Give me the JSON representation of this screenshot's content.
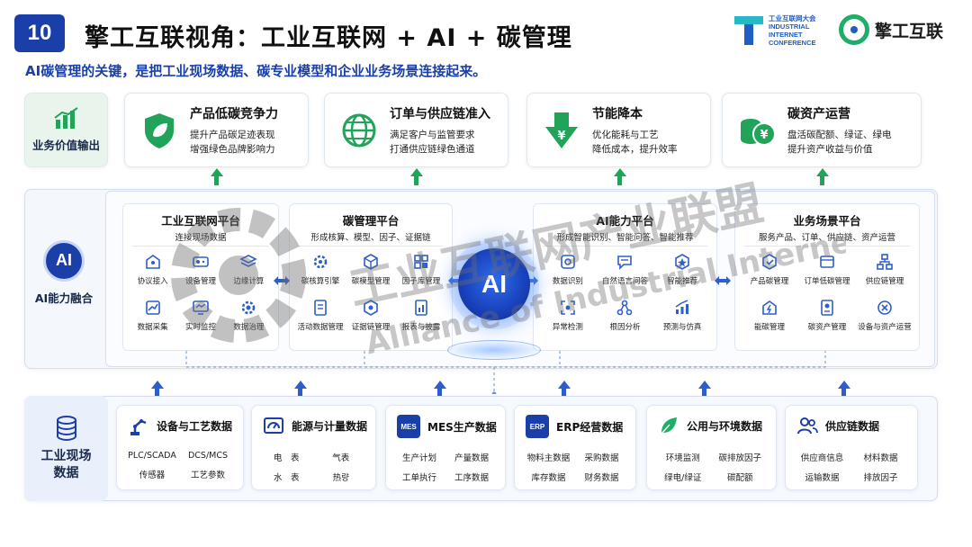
{
  "header": {
    "badge": "10",
    "title": "擎工互联视角：工业互联网 + AI + 碳管理",
    "subtitle": "AI碳管理的关键，是把工业现场数据、碳专业模型和企业业务场景连接起来。"
  },
  "logos": {
    "conference": [
      "工业互联网大会",
      "INDUSTRIAL",
      "INTERNET",
      "CONFERENCE"
    ],
    "brand": "擎工互联"
  },
  "colors": {
    "primary": "#1b3fa8",
    "green": "#22a35a",
    "blue_arrow": "#2d5ec9"
  },
  "value_row": {
    "label": "业务价值输出",
    "icon": "bar-chart-icon",
    "cards": [
      {
        "icon": "shield-leaf-icon",
        "title": "产品低碳竞争力",
        "lines": [
          "提升产品碳足迹表现",
          "增强绿色品牌影响力"
        ]
      },
      {
        "icon": "globe-icon",
        "title": "订单与供应链准入",
        "lines": [
          "满足客户与监管要求",
          "打通供应链绿色通道"
        ]
      },
      {
        "icon": "yuan-down-icon",
        "title": "节能降本",
        "lines": [
          "优化能耗与工艺",
          "降低成本，提升效率"
        ]
      },
      {
        "icon": "coins-icon",
        "title": "碳资产运营",
        "lines": [
          "盘活碳配额、绿证、绿电",
          "提升资产收益与价值"
        ]
      }
    ]
  },
  "ai_row": {
    "label": "AI能力融合",
    "circle": "AI",
    "center": "AI",
    "platforms": [
      {
        "title": "工业互联网平台",
        "subtitle": "连接现场数据",
        "items": [
          "协议接入",
          "设备管理",
          "边缘计算",
          "数据采集",
          "实时监控",
          "数据治理"
        ]
      },
      {
        "title": "碳管理平台",
        "subtitle": "形成核算、模型、因子、证据链",
        "items": [
          "碳核算引擎",
          "碳模型管理",
          "因子库管理",
          "活动数据管理",
          "证据链管理",
          "报表与披露"
        ]
      },
      {
        "title": "AI能力平台",
        "subtitle": "形成智能识别、智能问答、智能推荐",
        "items": [
          "数据识别",
          "自然语言问答",
          "智能推荐",
          "异常检测",
          "根因分析",
          "预测与仿真"
        ]
      },
      {
        "title": "业务场景平台",
        "subtitle": "服务产品、订单、供应链、资产运营",
        "items": [
          "产品碳管理",
          "订单低碳管理",
          "供应链管理",
          "能碳管理",
          "碳资产管理",
          "设备与资产运营"
        ]
      }
    ]
  },
  "data_row": {
    "label_lines": [
      "工业现场",
      "数据"
    ],
    "icon": "database-icon",
    "cards": [
      {
        "icon": "robot-arm-icon",
        "title": "设备与工艺数据",
        "items": [
          "PLC/SCADA",
          "DCS/MCS",
          "传感器",
          "工艺参数"
        ]
      },
      {
        "icon": "meter-icon",
        "title": "能源与计量数据",
        "items": [
          "电　表",
          "气表",
          "水　表",
          "热량"
        ]
      },
      {
        "icon": "mes-icon",
        "tag": "MES",
        "title": "MES生产数据",
        "items": [
          "生产计划",
          "产量数据",
          "工单执行",
          "工序数据"
        ]
      },
      {
        "icon": "erp-icon",
        "tag": "ERP",
        "title": "ERP经营数据",
        "items": [
          "物料主数据",
          "采购数据",
          "库存数据",
          "财务数据"
        ]
      },
      {
        "icon": "leaf-icon",
        "title": "公用与环境数据",
        "items": [
          "环境监测",
          "碳排放因子",
          "绿电/绿证",
          "碳配额"
        ]
      },
      {
        "icon": "users-icon",
        "title": "供应链数据",
        "items": [
          "供应商信息",
          "材料数据",
          "运输数据",
          "排放因子"
        ]
      }
    ]
  },
  "watermark": {
    "line1": "工业互联网产业联盟",
    "line2": "Alliance of Industrial Internet"
  }
}
